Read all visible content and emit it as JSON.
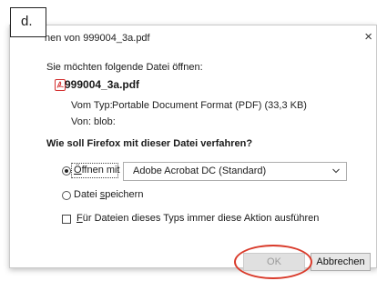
{
  "step_label": "d.",
  "dialog": {
    "title": "nen von 999004_3a.pdf",
    "close_glyph": "×",
    "prompt": "Sie möchten folgende Datei öffnen:",
    "file_icon": "pdf-icon",
    "file_name": "999004_3a.pdf",
    "type_label": "Vom Typ:",
    "type_value": "Portable Document Format (PDF) (33,3 KB)",
    "from_label": "Von:",
    "from_value": "blob:",
    "question": "Wie soll Firefox mit dieser Datei verfahren?",
    "open_with": {
      "label_first": "Ö",
      "label_rest": "ffnen mit",
      "selected": true,
      "app": "Adobe Acrobat DC (Standard)"
    },
    "save_file": {
      "label_plain": "Datei ",
      "label_underlined": "s",
      "label_rest": "peichern",
      "selected": false
    },
    "always": {
      "label_first": "F",
      "label_rest": "ür Dateien dieses Typs immer diese Aktion ausführen",
      "checked": false
    },
    "buttons": {
      "ok": "OK",
      "cancel": "Abbrechen"
    }
  },
  "colors": {
    "highlight": "#d93b2b",
    "pdf_red": "#d32f2f"
  }
}
